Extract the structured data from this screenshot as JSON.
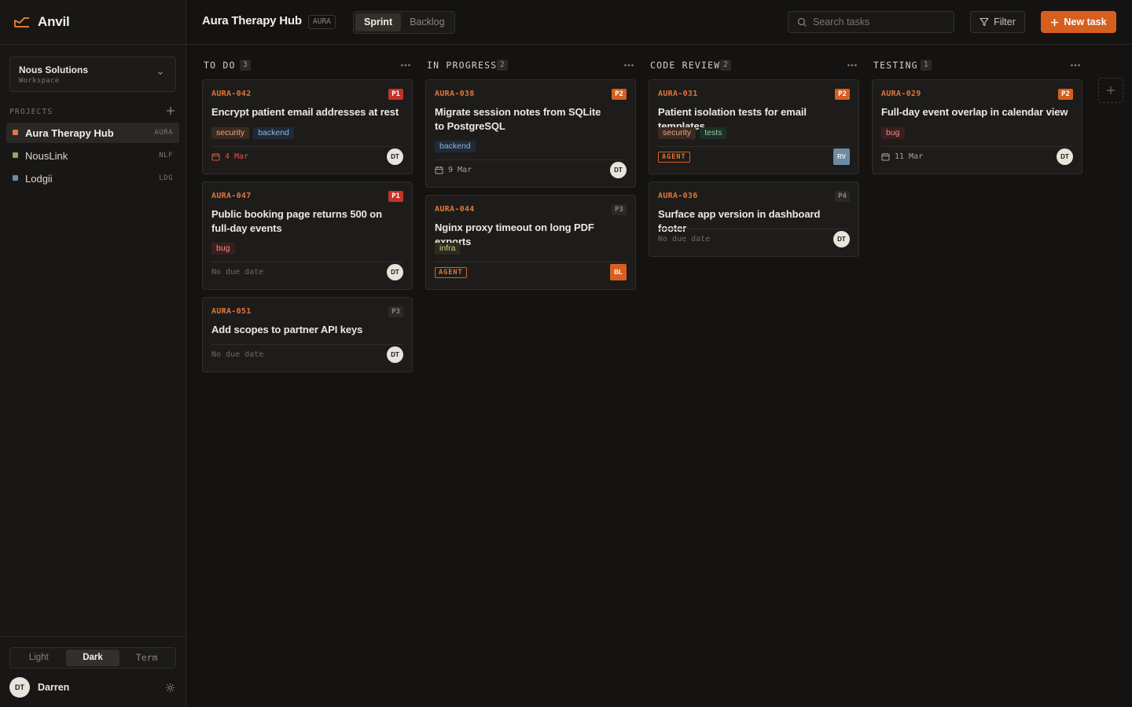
{
  "app": {
    "name": "Anvil",
    "accent": "#d65f1f"
  },
  "workspace": {
    "name": "Nous Solutions",
    "label": "Workspace"
  },
  "sidebar": {
    "projects_label": "PROJECTS",
    "projects": [
      {
        "name": "Aura Therapy Hub",
        "key": "AURA",
        "color": "#e0763a",
        "active": true
      },
      {
        "name": "NousLink",
        "key": "NLF",
        "color": "#8aa86a",
        "active": false
      },
      {
        "name": "Lodgii",
        "key": "LDG",
        "color": "#6c8ba5",
        "active": false
      }
    ],
    "themes": [
      "Light",
      "Dark",
      "Term"
    ],
    "active_theme": "Dark",
    "user": {
      "initials": "DT",
      "name": "Darren"
    }
  },
  "header": {
    "title": "Aura Therapy Hub",
    "key": "AURA",
    "tabs": [
      "Sprint",
      "Backlog"
    ],
    "active_tab": "Sprint",
    "search_placeholder": "Search tasks",
    "filter_label": "Filter",
    "new_task_label": "New task"
  },
  "board": {
    "columns": [
      {
        "title": "TO DO",
        "count": "3",
        "cards": [
          {
            "id": "AURA-042",
            "priority": "P1",
            "title": "Encrypt patient email addresses at rest",
            "tags": [
              "security",
              "backend"
            ],
            "due": "4 Mar",
            "assignee": "DT"
          },
          {
            "id": "AURA-047",
            "priority": "P1",
            "title": "Public booking page returns 500 on full-day events",
            "tags": [
              "bug"
            ],
            "due": "No due date",
            "assignee": "DT"
          },
          {
            "id": "AURA-051",
            "priority": "P3",
            "title": "Add scopes to partner API keys",
            "tags": [],
            "due": "No due date",
            "assignee": "DT"
          }
        ]
      },
      {
        "title": "IN PROGRESS",
        "count": "2",
        "cards": [
          {
            "id": "AURA-038",
            "priority": "P2",
            "title": "Migrate session notes from SQLite to PostgreSQL",
            "tags": [
              "backend"
            ],
            "due": "9 Mar",
            "assignee": "DT"
          },
          {
            "id": "AURA-044",
            "priority": "P3",
            "title": "Nginx proxy timeout on long PDF exports",
            "tags": [
              "infra"
            ],
            "agent": "AGENT",
            "assignee": "BL"
          }
        ]
      },
      {
        "title": "CODE REVIEW",
        "count": "2",
        "cards": [
          {
            "id": "AURA-031",
            "priority": "P2",
            "title": "Patient isolation tests for email templates",
            "tags": [
              "security",
              "tests"
            ],
            "agent": "AGENT",
            "assignee": "RV"
          },
          {
            "id": "AURA-036",
            "priority": "P4",
            "title": "Surface app version in dashboard footer",
            "tags": [],
            "due": "No due date",
            "assignee": "DT"
          }
        ]
      },
      {
        "title": "TESTING",
        "count": "1",
        "cards": [
          {
            "id": "AURA-029",
            "priority": "P2",
            "title": "Full-day event overlap in calendar view",
            "tags": [
              "bug"
            ],
            "due": "11 Mar",
            "assignee": "DT"
          }
        ]
      }
    ]
  }
}
